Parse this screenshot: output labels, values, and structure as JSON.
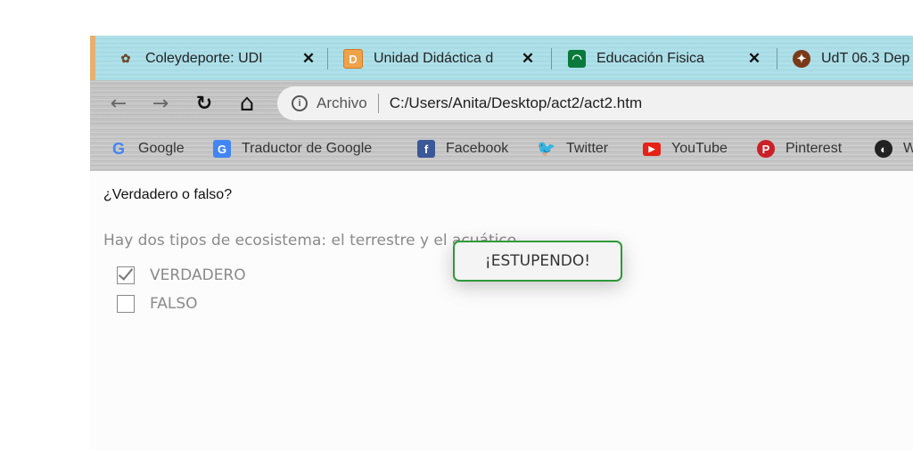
{
  "tabs": [
    {
      "title": "Coleydeporte: UDI",
      "favicon": "coleydeporte-favicon",
      "close": "✕"
    },
    {
      "title": "Unidad Didáctica d",
      "favicon": "unidad-didactica-favicon",
      "close": "✕"
    },
    {
      "title": "Educación Fisica",
      "favicon": "junta-andalucia-favicon",
      "close": "✕"
    },
    {
      "title": "UdT 06.3 Dep",
      "favicon": "udt-favicon"
    }
  ],
  "toolbar": {
    "back": "←",
    "forward": "→",
    "reload": "↻",
    "home": "⌂",
    "site_label": "Archivo",
    "url": "C:/Users/Anita/Desktop/act2/act2.htm"
  },
  "bookmarks": [
    {
      "label": "Google",
      "icon": "google-icon",
      "color": "#4285f4"
    },
    {
      "label": "Traductor de Google",
      "icon": "google-translate-icon",
      "color": "#4285f4"
    },
    {
      "label": "Facebook",
      "icon": "facebook-icon",
      "color": "#3b5998"
    },
    {
      "label": "Twitter",
      "icon": "twitter-icon",
      "color": "#1da1f2"
    },
    {
      "label": "YouTube",
      "icon": "youtube-icon",
      "color": "#e62117"
    },
    {
      "label": "Pinterest",
      "icon": "pinterest-icon",
      "color": "#cb2027"
    },
    {
      "label": "W",
      "icon": "wikipedia-icon",
      "color": "#222222"
    }
  ],
  "content": {
    "question": "¿Verdadero o falso?",
    "statement": "Hay dos tipos de ecosistema: el terrestre y el acuático",
    "options": [
      {
        "label": "VERDADERO",
        "checked": true
      },
      {
        "label": "FALSO",
        "checked": false
      }
    ],
    "popup": "¡ESTUPENDO!"
  },
  "colors": {
    "popup_border": "#2e9a3a",
    "muted_text": "#8a8a8a"
  }
}
